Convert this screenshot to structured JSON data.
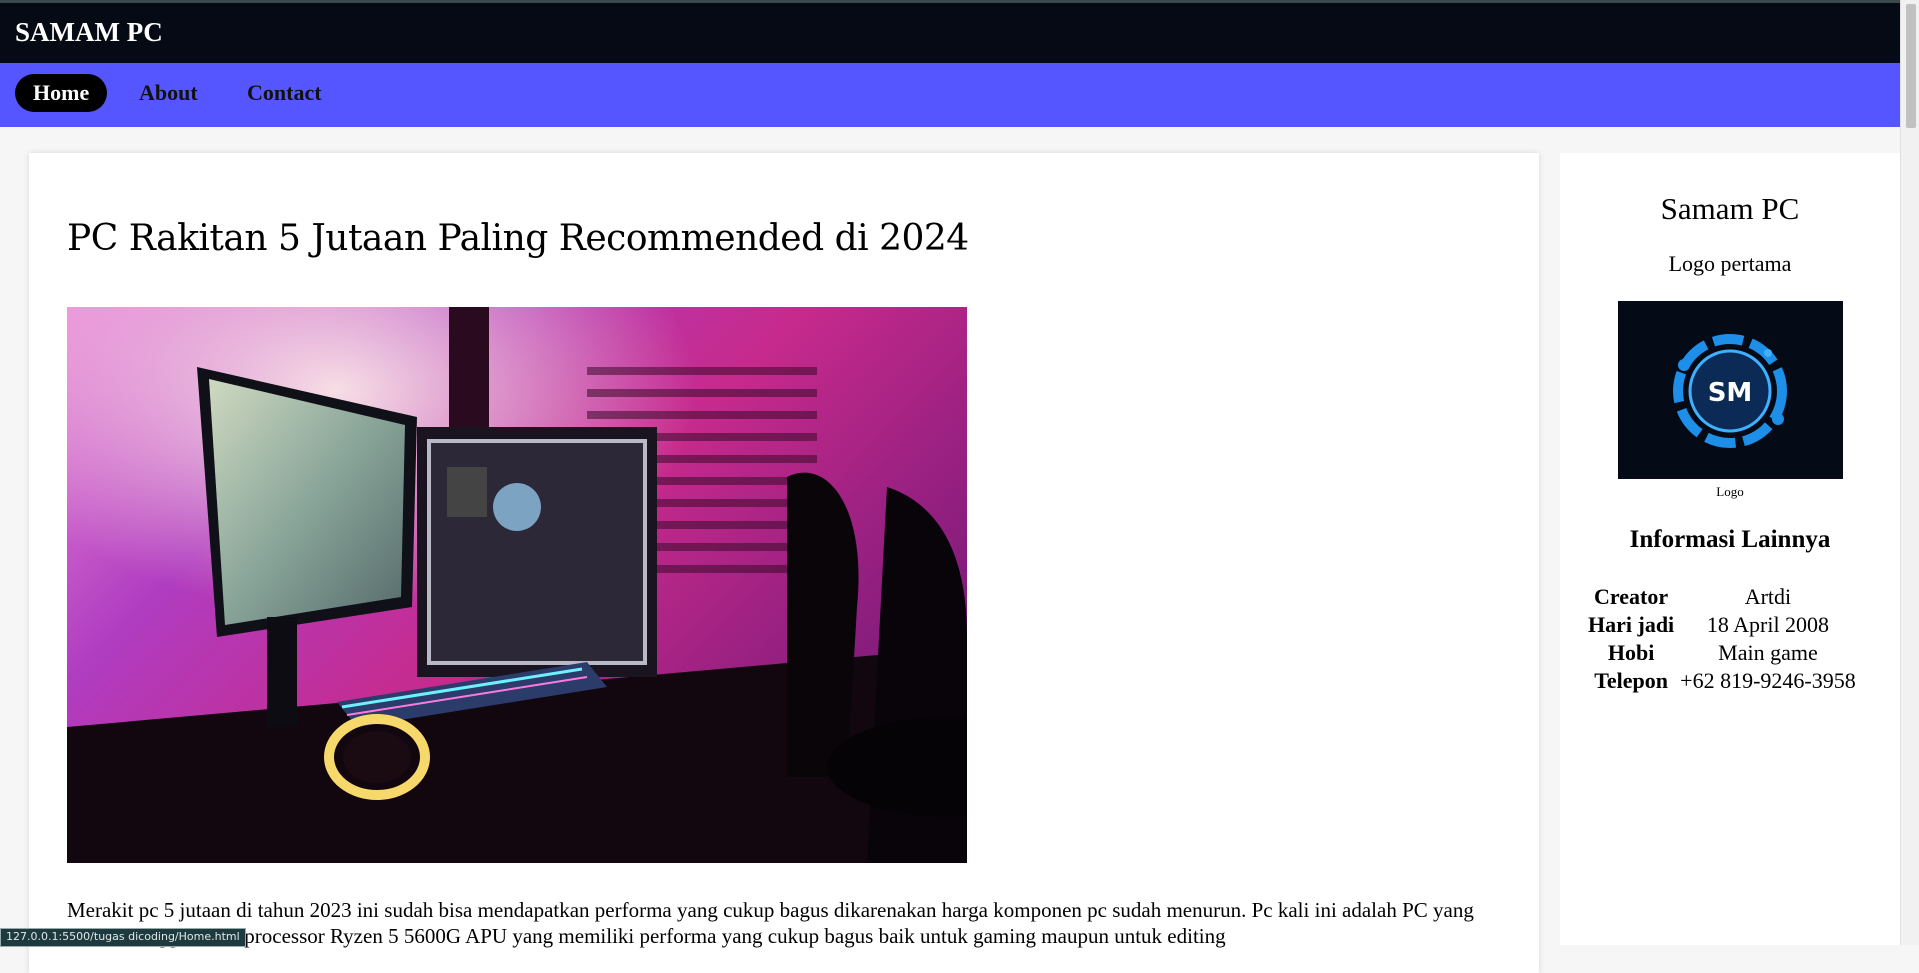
{
  "header": {
    "brand": "SAMAM PC"
  },
  "nav": {
    "items": [
      {
        "label": "Home",
        "active": true
      },
      {
        "label": "About"
      },
      {
        "label": "Contact"
      }
    ]
  },
  "article": {
    "title": "PC Rakitan 5 Jutaan Paling Recommended di 2024",
    "image_alt": "gaming PC setup",
    "body": "Merakit pc 5 jutaan di tahun 2023 ini sudah bisa mendapatkan performa yang cukup bagus dikarenakan harga komponen pc sudah menurun. Pc kali ini adalah PC yang sudah menggunakan processor Ryzen 5 5600G APU yang memiliki performa yang cukup bagus baik untuk gaming maupun untuk editing"
  },
  "sidebar": {
    "title": "Samam PC",
    "subtitle": "Logo pertama",
    "logo_text": "SM",
    "logo_caption": "Logo",
    "info_heading": "Informasi Lainnya",
    "info": [
      {
        "key": "Creator",
        "value": "Artdi"
      },
      {
        "key": "Hari jadi",
        "value": "18 April 2008"
      },
      {
        "key": "Hobi",
        "value": "Main game"
      },
      {
        "key": "Telepon",
        "value": "+62 819-9246-3958"
      }
    ]
  },
  "status_bar": {
    "url": "127.0.0.1:5500/tugas dicoding/Home.html"
  },
  "colors": {
    "header_bg": "#050a14",
    "nav_bg": "#5556ff",
    "logo_accent": "#1d8fe8"
  }
}
